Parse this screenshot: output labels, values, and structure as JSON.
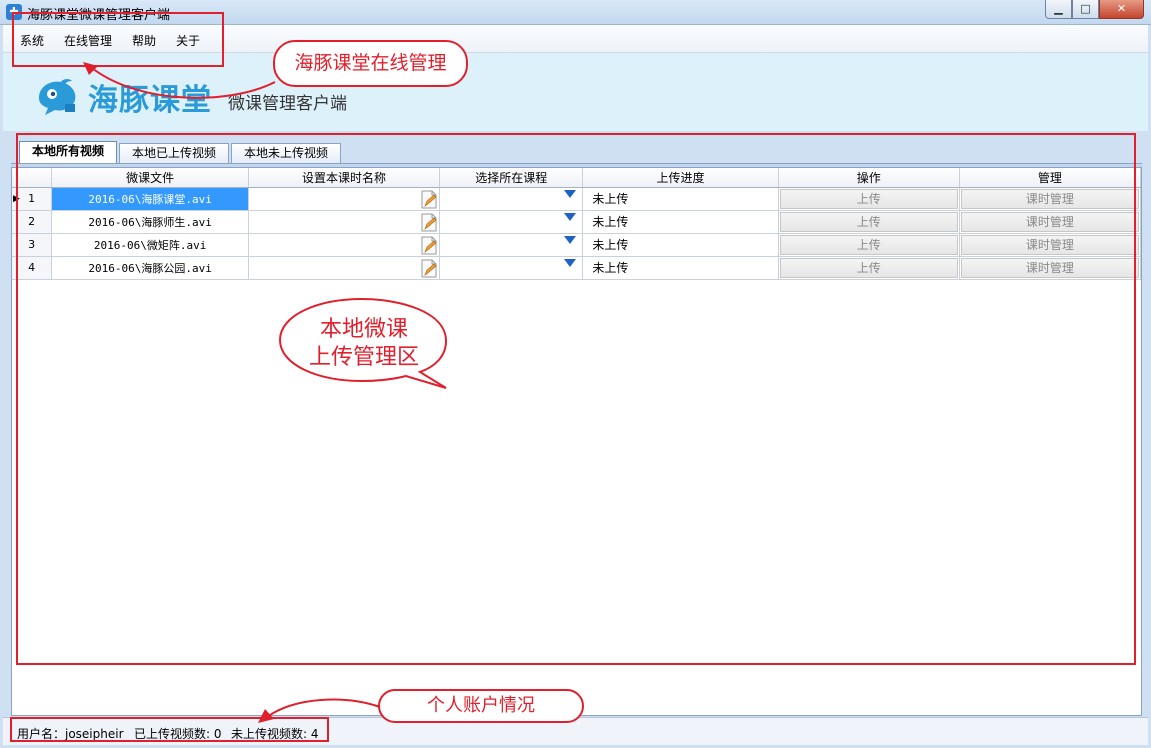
{
  "window": {
    "title": "海豚课堂微课管理客户端",
    "app_icon_glyph": "✚",
    "min_glyph": "▁",
    "max_glyph": "□",
    "close_glyph": "✕"
  },
  "menu": {
    "items": [
      "系统",
      "在线管理",
      "帮助",
      "关于"
    ]
  },
  "banner": {
    "logo_text": "海豚课堂",
    "subtitle": "微课管理客户端"
  },
  "tabs": [
    {
      "label": "本地所有视频",
      "active": true
    },
    {
      "label": "本地已上传视频",
      "active": false
    },
    {
      "label": "本地未上传视频",
      "active": false
    }
  ],
  "grid": {
    "columns": [
      "",
      "微课文件",
      "设置本课时名称",
      "选择所在课程",
      "上传进度",
      "操作",
      "管理"
    ],
    "rows": [
      {
        "num": "1",
        "file": "2016-06\\海豚课堂.avi",
        "name": "",
        "course": "",
        "progress": "未上传",
        "action": "上传",
        "manage": "课时管理"
      },
      {
        "num": "2",
        "file": "2016-06\\海豚师生.avi",
        "name": "",
        "course": "",
        "progress": "未上传",
        "action": "上传",
        "manage": "课时管理"
      },
      {
        "num": "3",
        "file": "2016-06\\微矩阵.avi",
        "name": "",
        "course": "",
        "progress": "未上传",
        "action": "上传",
        "manage": "课时管理"
      },
      {
        "num": "4",
        "file": "2016-06\\海豚公园.avi",
        "name": "",
        "course": "",
        "progress": "未上传",
        "action": "上传",
        "manage": "课时管理"
      }
    ],
    "row_pointer_glyph": "▶"
  },
  "status": {
    "username": "用户名：joseipheir",
    "uploaded": "已上传视频数: 0",
    "not_uploaded": "未上传视频数: 4"
  },
  "annotations": {
    "menu_callout": "海豚课堂在线管理",
    "grid_callout_line1": "本地微课",
    "grid_callout_line2": "上传管理区",
    "status_callout": "个人账户情况"
  },
  "colors": {
    "annotation_red": "#e0202c",
    "selection_blue": "#3399ff",
    "logo_blue": "#2a9ad8"
  }
}
